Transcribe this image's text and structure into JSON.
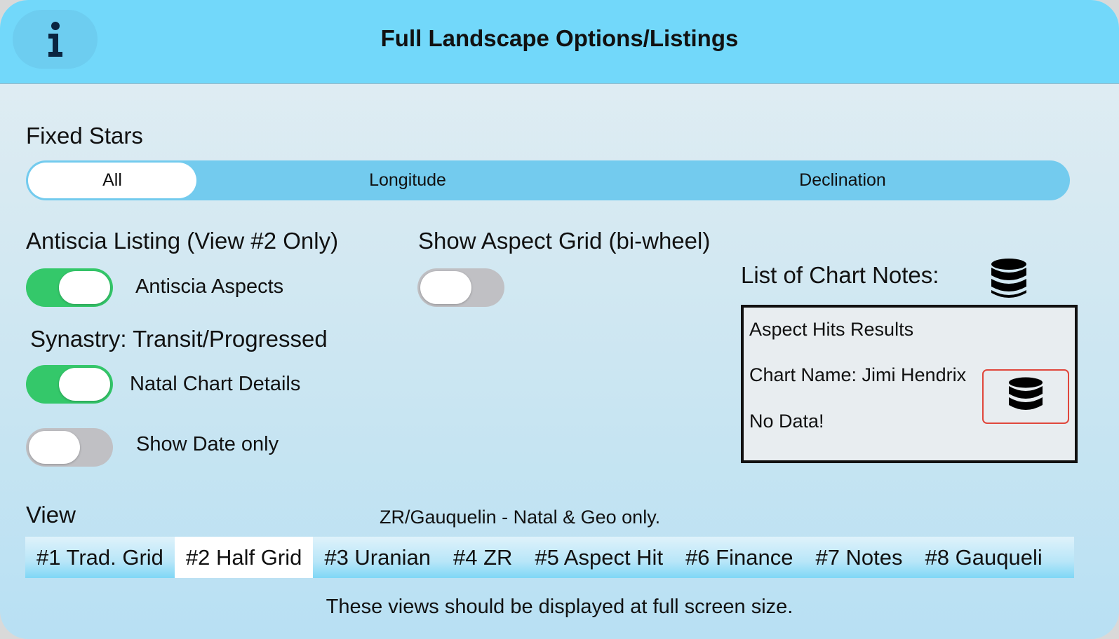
{
  "header": {
    "title": "Full Landscape Options/Listings",
    "info_icon": "info-icon"
  },
  "fixed_stars": {
    "label": "Fixed Stars",
    "options": [
      "All",
      "Longitude",
      "Declination"
    ],
    "selected": "All"
  },
  "antiscia": {
    "heading": "Antiscia Listing (View #2 Only)",
    "toggle_label": "Antiscia Aspects",
    "toggle_on": true
  },
  "aspect_grid": {
    "heading": "Show Aspect Grid (bi-wheel)",
    "toggle_on": false
  },
  "synastry": {
    "heading": "Synastry: Transit/Progressed",
    "natal_label": "Natal Chart Details",
    "natal_on": true,
    "date_label": "Show Date only",
    "date_on": false
  },
  "chart_notes": {
    "heading": "List of Chart Notes:",
    "icon": "database-icon",
    "lines": [
      "Aspect Hits Results",
      "Chart Name: Jimi Hendrix",
      "No Data!"
    ]
  },
  "view": {
    "label": "View",
    "note": "ZR/Gauquelin - Natal & Geo only.",
    "tabs": [
      "#1 Trad. Grid",
      "#2 Half Grid",
      "#3 Uranian",
      "#4 ZR",
      "#5 Aspect Hit",
      "#6 Finance",
      "#7 Notes",
      "#8 Gauqueli"
    ],
    "selected": "#2 Half Grid"
  },
  "footer": {
    "text": "These views should be displayed at full screen size."
  },
  "colors": {
    "header_bg": "#72d8fa",
    "toggle_on": "#34c86a",
    "toggle_off": "#c0c0c4",
    "segment_bg": "#73cbee",
    "db_button_border": "#e0473c"
  }
}
